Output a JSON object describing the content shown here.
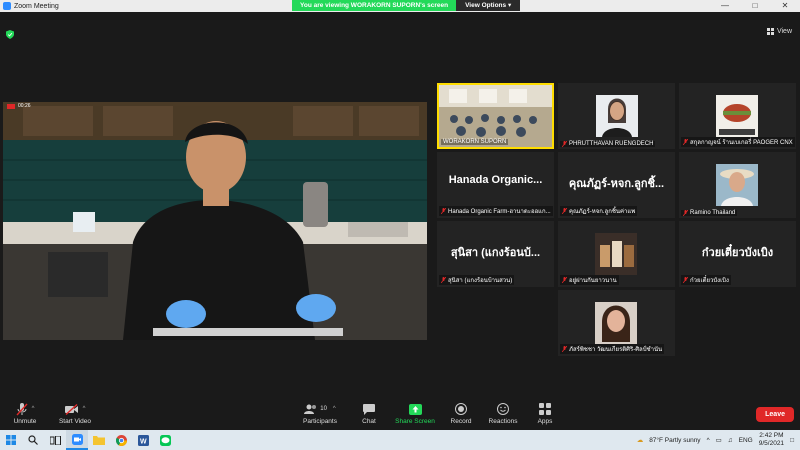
{
  "window": {
    "title": "Zoom Meeting"
  },
  "share_banner": {
    "message": "You are viewing WORAKORN SUPORN's screen",
    "view_options": "View Options"
  },
  "view_button": {
    "label": "View"
  },
  "main_video": {
    "timestamp": "00:26"
  },
  "participants": [
    {
      "name": "WORAKORN SUPORN",
      "muted": false,
      "active": true,
      "kind": "video-room"
    },
    {
      "name": "PHRUTTHAVAN RUENGDECH",
      "muted": true,
      "kind": "video-woman"
    },
    {
      "name": "สกุลกาญจน์ ร้านเบเกอรี่ PAOGER CNX",
      "muted": true,
      "kind": "photo-food"
    },
    {
      "name": "Hanada Organic Farm-ฮานาดะออแก...",
      "muted": true,
      "kind": "text",
      "display": "Hanada Organic..."
    },
    {
      "name": "คุณภัฏร์-หจก.ลูกชิ้นค่าแพ",
      "muted": true,
      "kind": "text",
      "display": "คุณภัฏร์-หจก.ลูกชิ้..."
    },
    {
      "name": "Ramino Thailand",
      "muted": true,
      "kind": "photo-woman-hat"
    },
    {
      "name": "สุนิสา (แกงร้อนบ้านสวน)",
      "muted": true,
      "kind": "text",
      "display": "สุนิสา (แกงร้อนบ้..."
    },
    {
      "name": "อยู่ผ่านกันยาวนาน",
      "muted": true,
      "kind": "photo-drinks"
    },
    {
      "name": "ก๋วยเตี๋ยวบังเบิง",
      "muted": true,
      "kind": "text",
      "display": "ก๋วยเตี๋ยวบังเบิง"
    },
    {
      "name": "ภัสร์พิชชา วัฒนเกียรติศิริ-ศิลป์ชำนัน",
      "muted": true,
      "kind": "photo-woman"
    }
  ],
  "toolbar": {
    "unmute": "Unmute",
    "start_video": "Start Video",
    "participants": "Participants",
    "participants_count": "10",
    "chat": "Chat",
    "share_screen": "Share Screen",
    "record": "Record",
    "reactions": "Reactions",
    "apps": "Apps",
    "leave": "Leave"
  },
  "taskbar": {
    "weather": "87°F  Partly sunny",
    "language": "ENG",
    "time": "2:42 PM",
    "date": "9/5/2021"
  },
  "colors": {
    "accent_green": "#23d959",
    "leave_red": "#e02828",
    "active_border": "#ffdd00"
  }
}
